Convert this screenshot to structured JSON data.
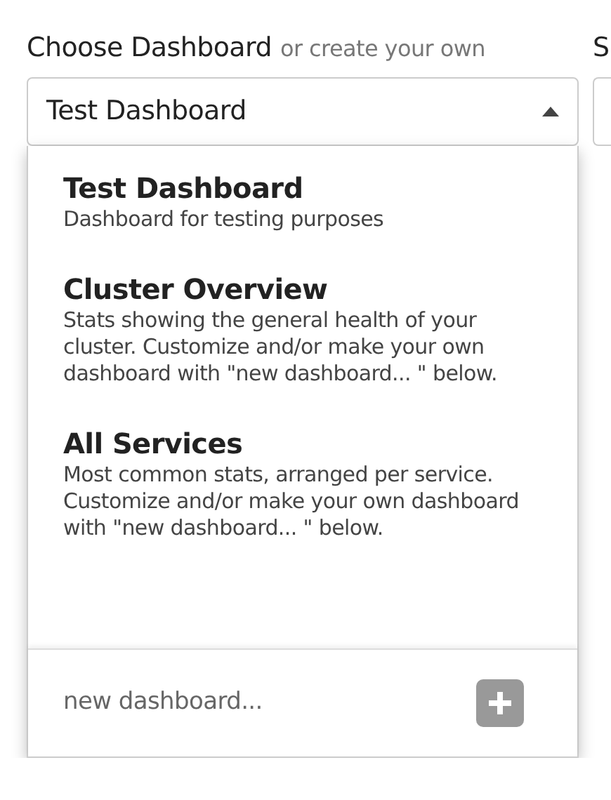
{
  "dashboard_picker": {
    "label": "Choose Dashboard",
    "hint": "or create your own",
    "value": "Test Dashboard",
    "expanded": true,
    "options": [
      {
        "title": "Test Dashboard",
        "description": "Dashboard for testing purposes"
      },
      {
        "title": "Cluster Overview",
        "description": "Stats showing the general health of your cluster. Customize and/or make your own dashboard with \"new dashboard... \" below."
      },
      {
        "title": "All Services",
        "description": "Most common stats, arranged per service. Customize and/or make your own dashboard with \"new dashboard... \" below."
      }
    ],
    "new_placeholder": "new dashboard..."
  },
  "next_field": {
    "label": "S"
  }
}
